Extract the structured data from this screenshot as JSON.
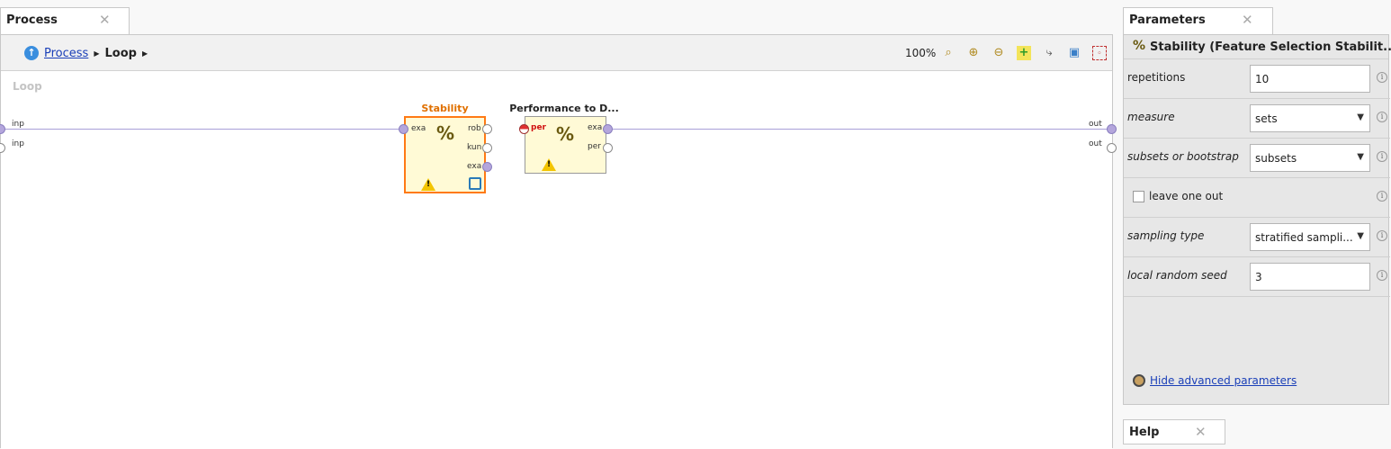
{
  "tabs": {
    "process": {
      "label": "Process",
      "close": "✕"
    },
    "parameters": {
      "label": "Parameters",
      "close": "✕"
    },
    "help": {
      "label": "Help",
      "close": "✕"
    }
  },
  "breadcrumb": {
    "root": "Process",
    "current": "Loop"
  },
  "toolbar": {
    "zoom": "100%"
  },
  "canvas": {
    "label": "Loop",
    "left_ports": [
      "inp",
      "inp"
    ],
    "right_ports": [
      "out",
      "out"
    ]
  },
  "operators": {
    "stability": {
      "title": "Stability",
      "in_ports": [
        "exa"
      ],
      "out_ports": [
        "rob",
        "kun",
        "exa"
      ],
      "icon": "percent-icon",
      "title_color": "#e07000"
    },
    "performance": {
      "title": "Performance to D...",
      "in_ports": [
        "per"
      ],
      "out_ports": [
        "exa",
        "per"
      ],
      "icon": "percent-icon"
    }
  },
  "parameters": {
    "operator_title": "Stability (Feature Selection Stabilit...",
    "rows": [
      {
        "name": "repetitions",
        "value": "10",
        "type": "text",
        "italic": false
      },
      {
        "name": "measure",
        "value": "sets",
        "type": "select",
        "italic": true
      },
      {
        "name": "subsets or bootstrap",
        "value": "subsets",
        "type": "select",
        "italic": true
      },
      {
        "name": "leave one out",
        "checked": false,
        "type": "checkbox",
        "italic": false
      },
      {
        "name": "sampling type",
        "value": "stratified sampli...",
        "type": "select",
        "italic": true
      },
      {
        "name": "local random seed",
        "value": "3",
        "type": "text",
        "italic": true
      }
    ],
    "advanced_link": "Hide advanced parameters"
  }
}
